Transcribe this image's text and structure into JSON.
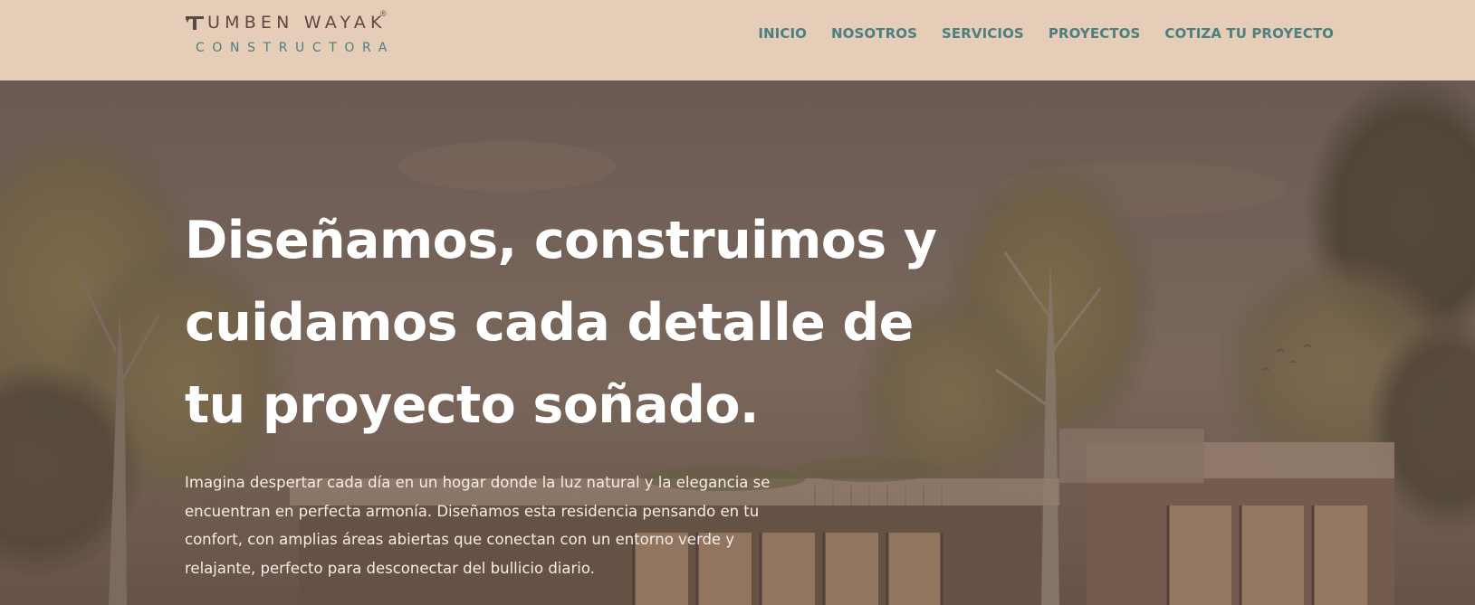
{
  "brand": {
    "name_top": "UMBEN WAYAK",
    "registered_mark": "®",
    "name_bottom": "CONSTRUCTORA"
  },
  "nav": {
    "items": [
      {
        "label": "INICIO"
      },
      {
        "label": "NOSOTROS"
      },
      {
        "label": "SERVICIOS"
      },
      {
        "label": "PROYECTOS"
      },
      {
        "label": "COTIZA TU PROYECTO"
      }
    ]
  },
  "hero": {
    "title": "Diseñamos, construimos y cuidamos cada detalle de tu proyecto soñado.",
    "description": "Imagina despertar cada día en un hogar donde la luz natural y la elegancia se encuentran en perfecta armonía. Diseñamos esta residencia pensando en tu confort, con amplias áreas abiertas que conectan con un entorno verde y relajante, perfecto para desconectar del bullicio diario."
  },
  "colors": {
    "header_bg": "#e6cdb7",
    "nav_text": "#4c7f80",
    "logo_dark": "#5b4a44",
    "logo_teal": "#4d7f82",
    "hero_overlay": "#5e4c44",
    "hero_text": "#ffffff"
  }
}
